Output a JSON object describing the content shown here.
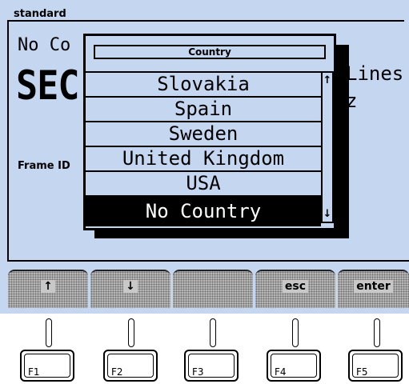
{
  "group": {
    "title": "standard"
  },
  "background": {
    "country_partial": "No Co",
    "standard_partial": "SEC",
    "lines_partial": "Lines",
    "freq_partial": "z",
    "frame_id_label": "Frame ID"
  },
  "popup": {
    "title": "Country",
    "items": [
      "Slovakia",
      "Spain",
      "Sweden",
      "United Kingdom",
      "USA",
      "No Country"
    ],
    "selected": "No Country",
    "scroll_up": "↑",
    "scroll_down": "↓"
  },
  "softkeys": [
    "↑",
    "↓",
    "",
    "esc",
    "enter"
  ],
  "fkeys": [
    "F1",
    "F2",
    "F3",
    "F4",
    "F5"
  ]
}
